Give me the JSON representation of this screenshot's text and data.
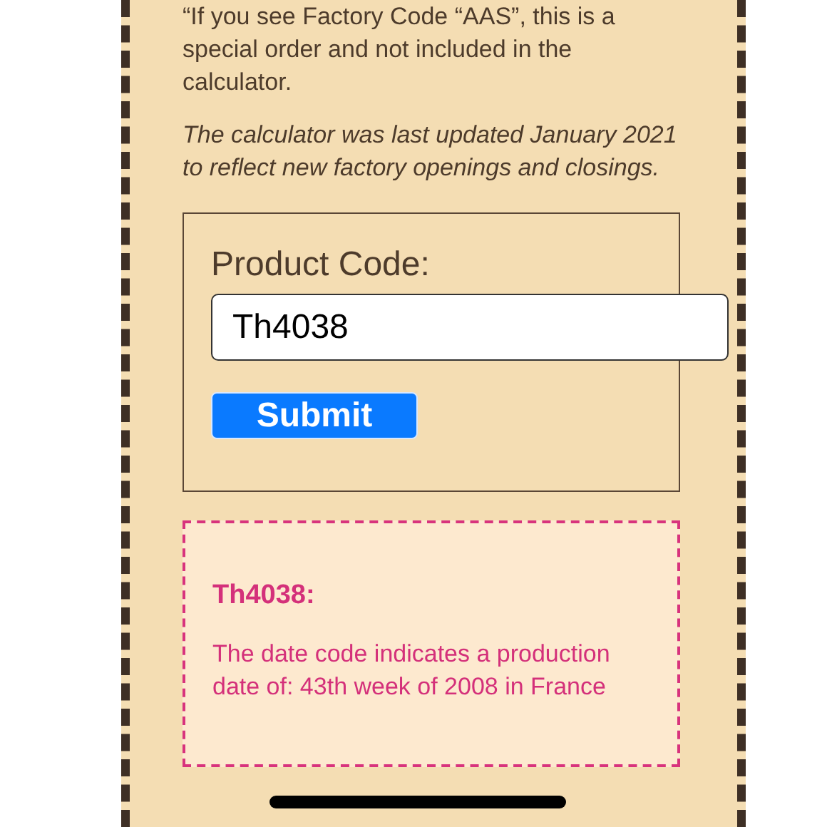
{
  "notes": [
    {
      "text": "“If you see Factory Code “AAS”, this is a special order and not included in the calculator.",
      "italic": false
    },
    {
      "text": "The calculator was last updated January 2021 to reflect new factory openings and closings.",
      "italic": true
    }
  ],
  "form": {
    "label": "Product Code:",
    "value": "Th4038",
    "button": "Submit"
  },
  "result": {
    "code": "Th4038:",
    "message": "The date code indicates a production date of: 43th week of 2008 in France"
  }
}
